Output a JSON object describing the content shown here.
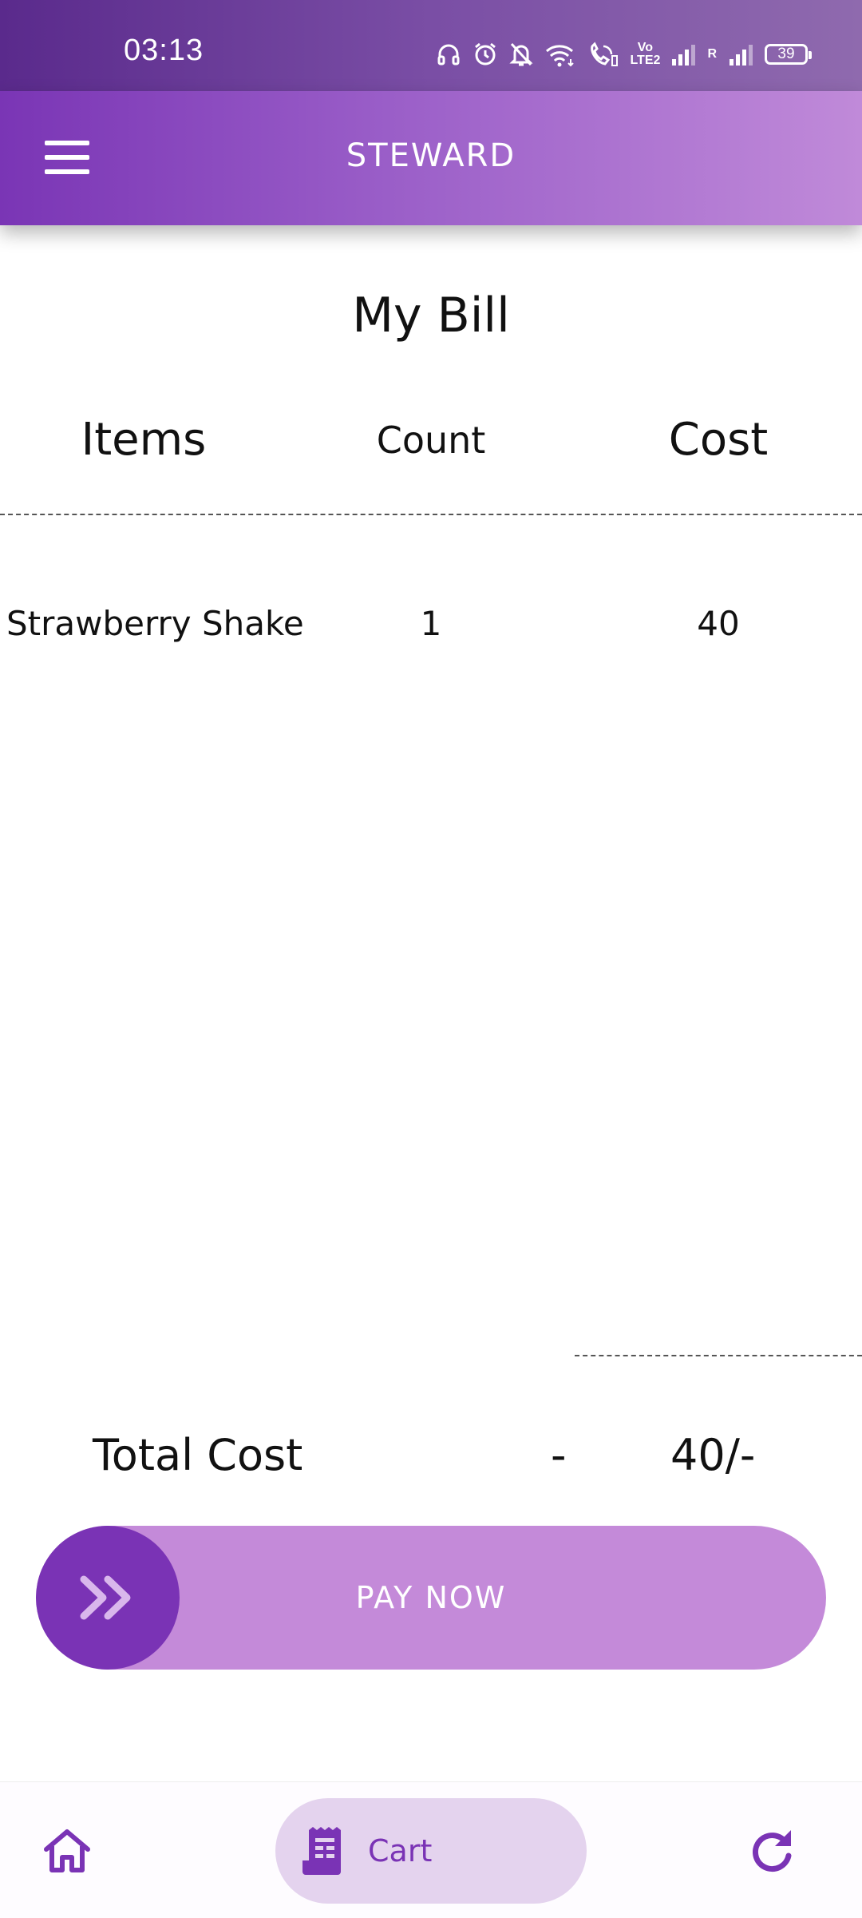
{
  "status_bar": {
    "time": "03:13",
    "network_tag_1": "Vo LTE2",
    "roaming_tag": "R",
    "battery_level": "39"
  },
  "app_bar": {
    "title": "STEWARD",
    "menu_icon": "hamburger-menu-icon"
  },
  "bill": {
    "title": "My Bill",
    "columns": [
      "Items",
      "Count",
      "Cost"
    ],
    "rows": [
      {
        "item": "Strawberry Shake",
        "count": "1",
        "cost": "40"
      }
    ],
    "total_label": "Total Cost",
    "total_separator": "-",
    "total_value": "40/-"
  },
  "pay": {
    "label": "PAY NOW",
    "knob_icon": "double-chevron-right-icon"
  },
  "bottom_nav": {
    "home_icon": "home-icon",
    "cart_icon": "receipt-icon",
    "cart_label": "Cart",
    "refresh_icon": "refresh-icon"
  },
  "colors": {
    "primary": "#7a33b5",
    "primary_light": "#c48ad9",
    "cart_pill": "#e4d3ee",
    "text": "#111111"
  }
}
